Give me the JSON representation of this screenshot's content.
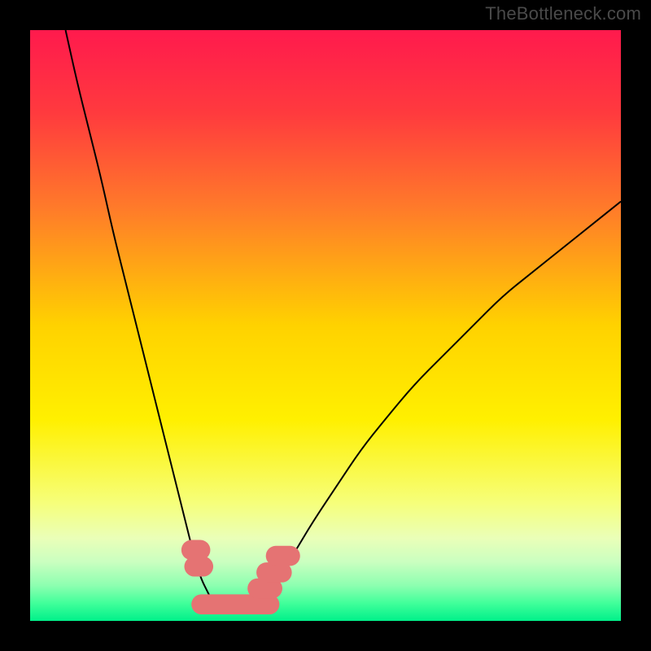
{
  "watermark": "TheBottleneck.com",
  "chart_data": {
    "type": "line",
    "title": "",
    "xlabel": "",
    "ylabel": "",
    "xlim": [
      0,
      100
    ],
    "ylim": [
      0,
      100
    ],
    "background_gradient_stops": [
      {
        "y": 0,
        "color": "#ff1a4d"
      },
      {
        "y": 14,
        "color": "#ff3a3e"
      },
      {
        "y": 30,
        "color": "#ff7a2a"
      },
      {
        "y": 50,
        "color": "#ffd200"
      },
      {
        "y": 66,
        "color": "#fff000"
      },
      {
        "y": 80,
        "color": "#f6ff7a"
      },
      {
        "y": 86,
        "color": "#eaffb8"
      },
      {
        "y": 90,
        "color": "#caffc0"
      },
      {
        "y": 94,
        "color": "#8dffb0"
      },
      {
        "y": 97,
        "color": "#41ff9a"
      },
      {
        "y": 100,
        "color": "#00f08a"
      }
    ],
    "series": [
      {
        "name": "curve-left",
        "color": "#000000",
        "width": 2.0,
        "x": [
          6,
          8,
          10,
          12,
          14,
          16,
          18,
          20,
          22,
          24,
          26,
          28,
          29,
          30,
          31,
          32
        ],
        "y": [
          100,
          91,
          83,
          75,
          66,
          58,
          50,
          42,
          34,
          26,
          18,
          10,
          7,
          5,
          3,
          2
        ]
      },
      {
        "name": "curve-right",
        "color": "#000000",
        "width": 2.0,
        "x": [
          38,
          40,
          42,
          45,
          48,
          52,
          56,
          60,
          65,
          70,
          75,
          80,
          85,
          90,
          95,
          100
        ],
        "y": [
          2,
          4,
          7,
          12,
          17,
          23,
          29,
          34,
          40,
          45,
          50,
          55,
          59,
          63,
          67,
          71
        ]
      },
      {
        "name": "bottom-salmon-band",
        "type": "marker-band",
        "color": "#e57373",
        "segments": [
          {
            "x0": 27.3,
            "x1": 28.8,
            "y": 12.0
          },
          {
            "x0": 27.8,
            "x1": 29.3,
            "y": 9.2
          },
          {
            "x0": 29.0,
            "x1": 40.5,
            "y": 2.8
          },
          {
            "x0": 38.5,
            "x1": 41.0,
            "y": 5.5
          },
          {
            "x0": 40.0,
            "x1": 42.6,
            "y": 8.2
          },
          {
            "x0": 41.6,
            "x1": 44.0,
            "y": 11.0
          }
        ],
        "thickness_pct": 3.4
      }
    ]
  }
}
